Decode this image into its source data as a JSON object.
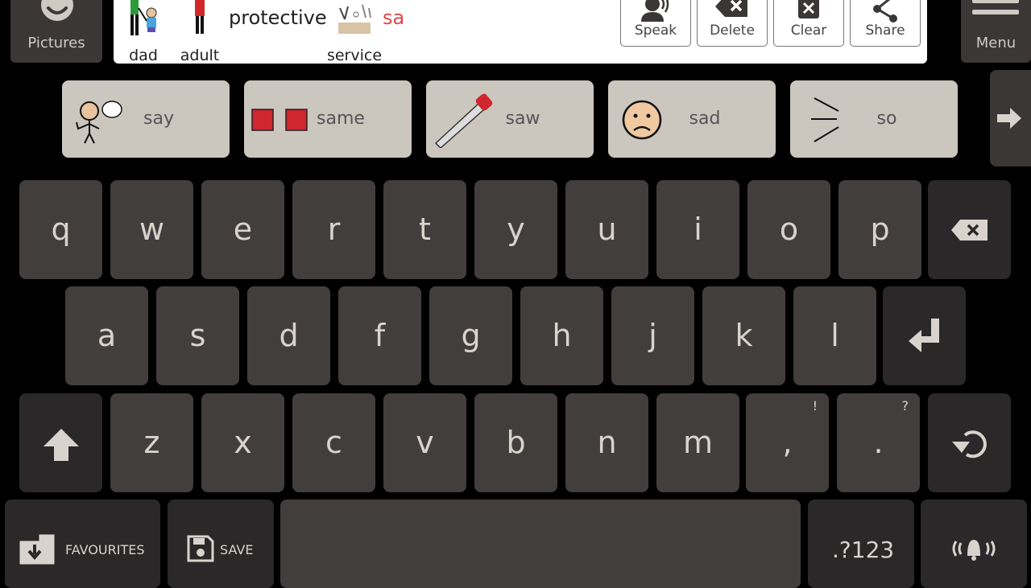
{
  "top_bar": {
    "pictures_label": "Pictures",
    "menu_label": "Menu",
    "message": {
      "words": [
        {
          "label": "dad",
          "has_symbol": true
        },
        {
          "label": "adult",
          "has_symbol": true
        },
        {
          "label": "protective",
          "has_symbol": false
        },
        {
          "label": "service",
          "has_symbol": true
        }
      ],
      "current_input": "sa"
    },
    "actions": [
      {
        "label": "Speak",
        "icon": "speak-icon"
      },
      {
        "label": "Delete",
        "icon": "delete-icon"
      },
      {
        "label": "Clear",
        "icon": "clear-icon"
      },
      {
        "label": "Share",
        "icon": "share-icon"
      }
    ]
  },
  "predictions": [
    {
      "label": "say",
      "icon": "say-symbol"
    },
    {
      "label": "same",
      "icon": "same-symbol"
    },
    {
      "label": "saw",
      "icon": "saw-symbol"
    },
    {
      "label": "sad",
      "icon": "sad-face-symbol"
    },
    {
      "label": "so",
      "icon": "so-symbol"
    }
  ],
  "keyboard": {
    "row1": [
      "q",
      "w",
      "e",
      "r",
      "t",
      "y",
      "u",
      "i",
      "o",
      "p"
    ],
    "row2": [
      "a",
      "s",
      "d",
      "f",
      "g",
      "h",
      "j",
      "k",
      "l"
    ],
    "row3": [
      "z",
      "x",
      "c",
      "v",
      "b",
      "n",
      "m"
    ],
    "comma": {
      "label": ",",
      "alt": "!"
    },
    "period": {
      "label": ".",
      "alt": "?"
    },
    "favourites_label": "FAVOURITES",
    "save_label": "SAVE",
    "numbers_label": ".?123"
  },
  "colors": {
    "key": "#423e3d",
    "key_dark": "#2a2828",
    "prediction": "#cbc6be",
    "partial_word": "#e04646"
  }
}
